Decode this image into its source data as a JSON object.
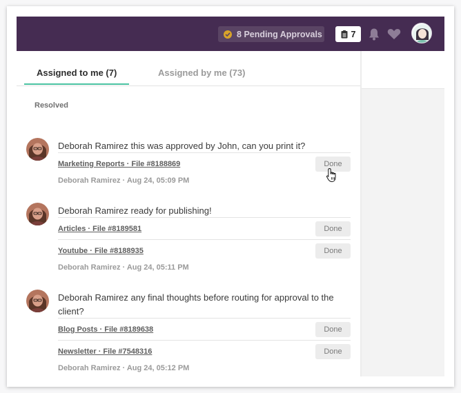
{
  "header": {
    "pending_count": "8",
    "pending_label": "Pending Approvals",
    "task_count": "7",
    "icons": [
      "check-circle-icon",
      "task-list-icon",
      "bell-icon",
      "heart-icon",
      "user-avatar"
    ],
    "colors": {
      "bar": "#452c52",
      "accent": "#49c2a1"
    }
  },
  "tabs": [
    {
      "label": "Assigned to me (7)",
      "active": true
    },
    {
      "label": "Assigned by me (73)",
      "active": false
    }
  ],
  "section_label": "Resolved",
  "threads": [
    {
      "message": "Deborah Ramirez this was approved by John, can you print it?",
      "files": [
        {
          "label": "Marketing Reports · File #8188869",
          "action": "Done"
        }
      ],
      "meta": "Deborah Ramirez · Aug 24, 05:09 PM"
    },
    {
      "message": "Deborah Ramirez ready for publishing!",
      "files": [
        {
          "label": "Articles · File #8189581",
          "action": "Done"
        },
        {
          "label": "Youtube · File #8188935",
          "action": "Done"
        }
      ],
      "meta": "Deborah Ramirez · Aug 24, 05:11 PM"
    },
    {
      "message": "Deborah Ramirez any final thoughts before routing for approval to the client?",
      "files": [
        {
          "label": "Blog Posts · File #8189638",
          "action": "Done"
        },
        {
          "label": "Newsletter · File #7548316",
          "action": "Done"
        }
      ],
      "meta": "Deborah Ramirez · Aug 24, 05:12 PM"
    }
  ]
}
